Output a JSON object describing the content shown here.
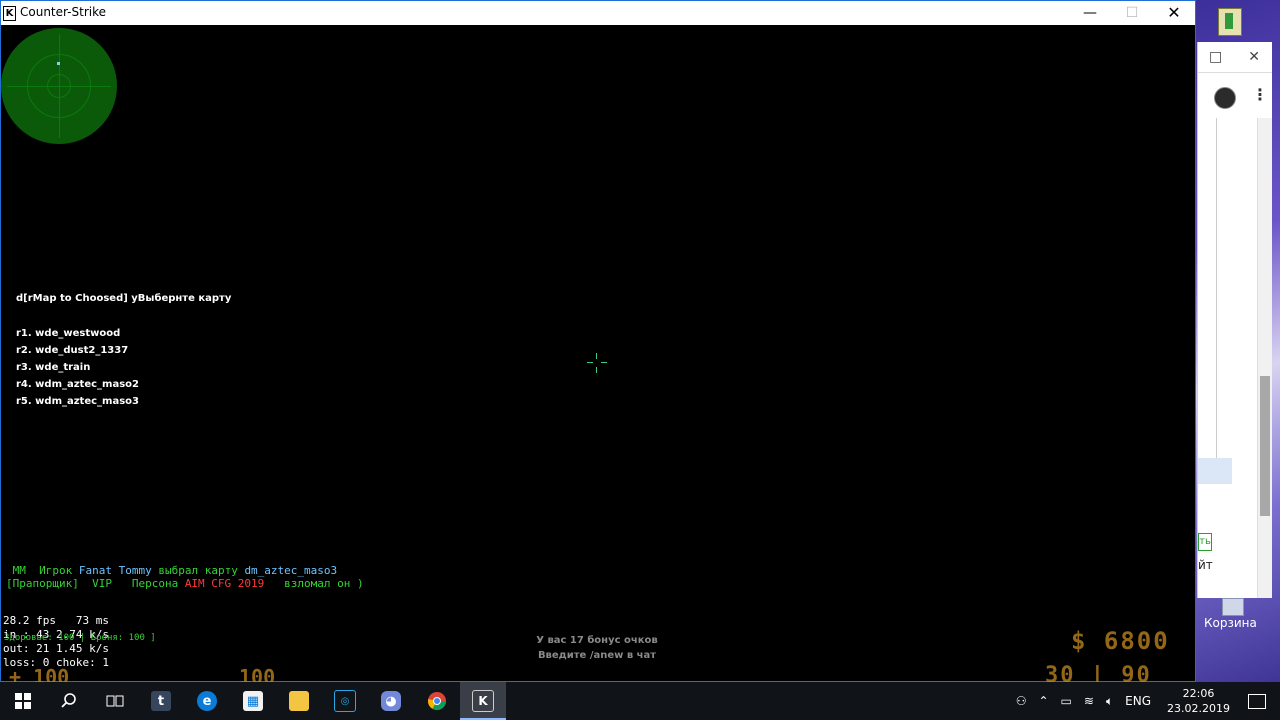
{
  "window": {
    "title": "Counter-Strike",
    "minimize_icon": "minimize-icon",
    "maximize_icon": "maximize-icon",
    "close_icon": "close-icon"
  },
  "map_menu": {
    "header": "d[rMap to Choosed] уВыбернте карту",
    "items": [
      "r1. wde_westwood",
      "r2. wde_dust2_1337",
      "r3. wde_train",
      "r4. wdm_aztec_maso2",
      "r5. wdm_aztec_maso3"
    ]
  },
  "chat": {
    "line1_a": " MM  Игрок ",
    "line1_b": "Fanat Tommy",
    "line1_c": " выбрал карту ",
    "line1_d": "dm_aztec_maso3",
    "line2_a": "[Прапорщик]  VIP   Персона ",
    "line2_b": "AIM CFG 2019",
    "line2_c": "   взломал он )"
  },
  "netgraph": {
    "fps": "28.2 fps   73 ms",
    "in": "in : 43 2.74 k/s",
    "out": "out: 21 1.45 k/s",
    "loss": "loss: 0 choke: 1"
  },
  "status_line": "Здоровье: 100 | Броня: 100 ]",
  "bonus": {
    "line1": "У вас 17 бонус очков",
    "line2": "Введите /anew в чат"
  },
  "hud": {
    "money": "$  6800",
    "ammo": "30 | 90",
    "health": "+ 100",
    "armor": "100"
  },
  "desktop": {
    "recycle_bin": "Корзина",
    "partial_text": "йт",
    "green_button": "ть"
  },
  "taskbar": {
    "apps": [
      "start-icon",
      "search-icon",
      "task-view-icon",
      "tumblr-icon",
      "edge-icon",
      "store-icon",
      "file-explorer-icon",
      "app-icon",
      "discord-icon",
      "chrome-icon",
      "counter-strike-icon"
    ],
    "tumblr_glyph": "t",
    "language": "ENG",
    "time": "22:06",
    "date": "23.02.2019"
  },
  "colors": {
    "accent_window": "#1f6fd6",
    "chat_green": "#35d235",
    "chat_cyan": "#6ec3ff",
    "chat_red": "#ff3b3b",
    "hud_orange": "#c58a1f"
  }
}
